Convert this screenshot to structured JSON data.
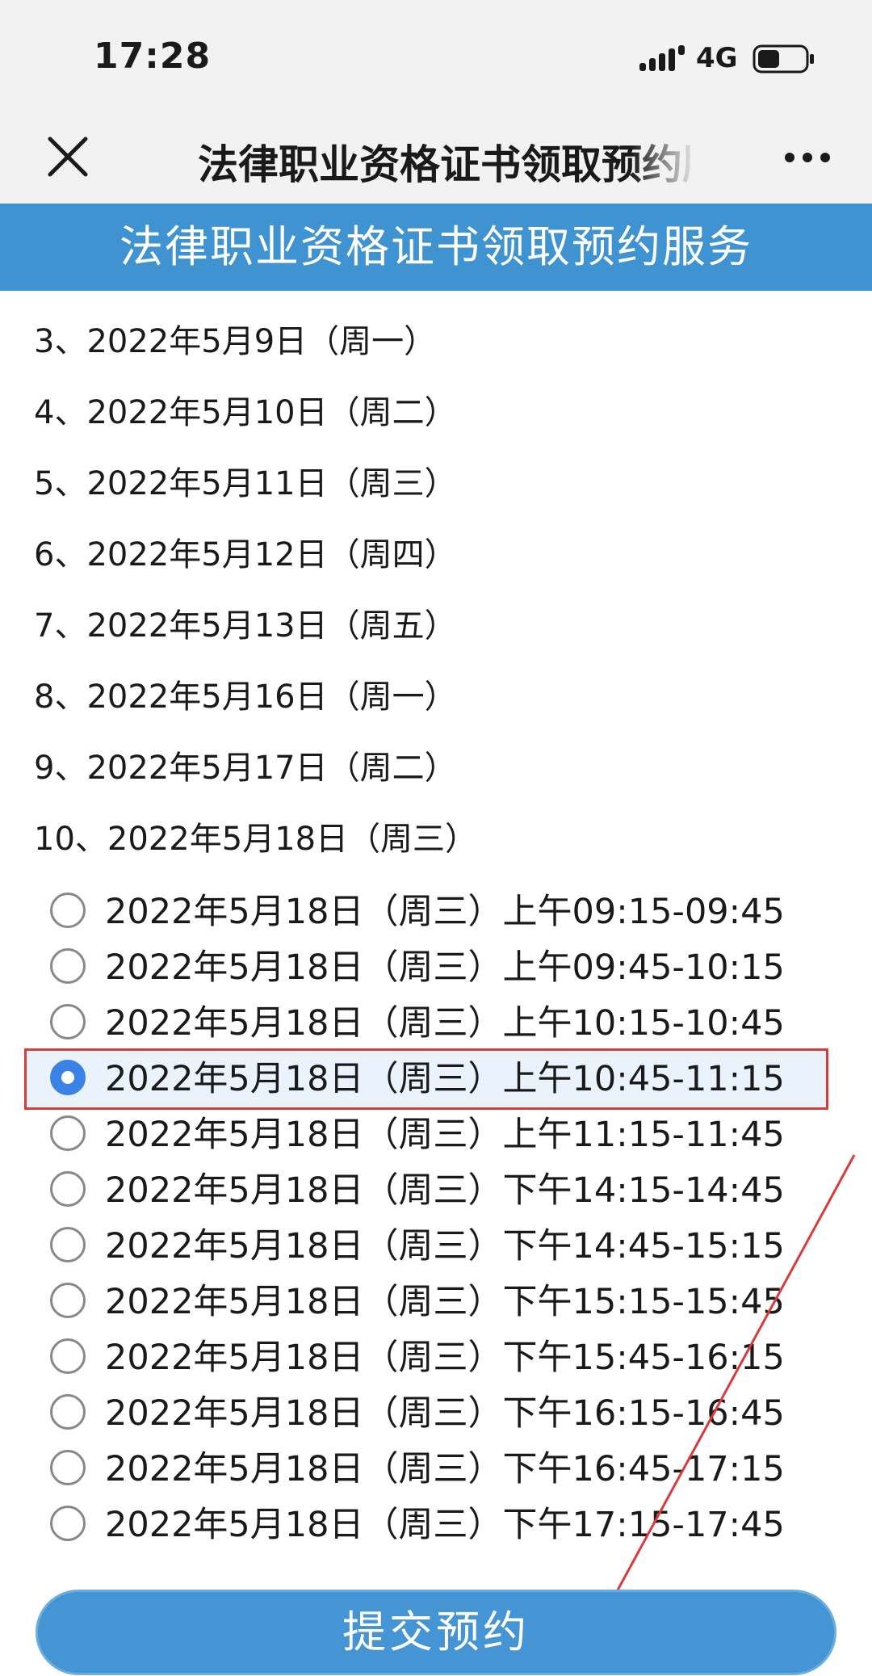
{
  "status_bar": {
    "time": "17:28",
    "network": "4G"
  },
  "nav": {
    "title": "法律职业资格证书领取预约服务"
  },
  "banner": {
    "title": "法律职业资格证书领取预约服务"
  },
  "dates": [
    "3、2022年5月9日（周一）",
    "4、2022年5月10日（周二）",
    "5、2022年5月11日（周三）",
    "6、2022年5月12日（周四）",
    "7、2022年5月13日（周五）",
    "8、2022年5月16日（周一）",
    "9、2022年5月17日（周二）",
    "10、2022年5月18日（周三）"
  ],
  "slots": [
    "2022年5月18日（周三）上午09:15-09:45",
    "2022年5月18日（周三）上午09:45-10:15",
    "2022年5月18日（周三）上午10:15-10:45",
    "2022年5月18日（周三）上午10:45-11:15",
    "2022年5月18日（周三）上午11:15-11:45",
    "2022年5月18日（周三）下午14:15-14:45",
    "2022年5月18日（周三）下午14:45-15:15",
    "2022年5月18日（周三）下午15:15-15:45",
    "2022年5月18日（周三）下午15:45-16:15",
    "2022年5月18日（周三）下午16:15-16:45",
    "2022年5月18日（周三）下午16:45-17:15",
    "2022年5月18日（周三）下午17:15-17:45"
  ],
  "selected_slot_index": 3,
  "submit": {
    "label": "提交预约"
  },
  "colors": {
    "accent": "#3f93d1",
    "radio_checked": "#3b82e6",
    "annotation": "#d93a3a"
  },
  "icons": [
    "close-icon",
    "more-icon",
    "signal-icon",
    "battery-icon"
  ]
}
